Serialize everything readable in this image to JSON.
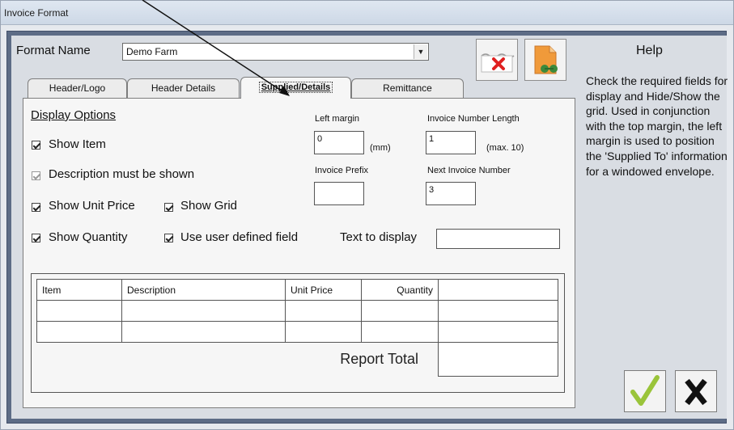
{
  "window": {
    "title": "Invoice Format"
  },
  "format": {
    "label": "Format Name",
    "value": "Demo Farm"
  },
  "toolbar": {
    "delete_icon": "delete-document-icon",
    "export_icon": "document-export-icon"
  },
  "tabs": [
    {
      "label": "Header/Logo"
    },
    {
      "label": "Header Details"
    },
    {
      "label": "Supplied/Details"
    },
    {
      "label": "Remittance"
    }
  ],
  "options": {
    "heading": "Display Options",
    "show_item": "Show Item",
    "description_must_be_shown": "Description must be shown",
    "show_unit_price": "Show Unit Price",
    "show_grid": "Show Grid",
    "show_quantity": "Show Quantity",
    "use_user_defined_field": "Use user defined field",
    "text_to_display": "Text to display",
    "text_to_display_value": ""
  },
  "fields": {
    "left_margin_label": "Left margin",
    "left_margin_value": "0",
    "left_margin_unit": "(mm)",
    "invoice_number_length_label": "Invoice Number Length",
    "invoice_number_length_value": "1",
    "invoice_number_length_hint": "(max. 10)",
    "invoice_prefix_label": "Invoice Prefix",
    "invoice_prefix_value": "",
    "next_invoice_number_label": "Next Invoice Number",
    "next_invoice_number_value": "3"
  },
  "preview_grid": {
    "headers": [
      "Item",
      "Description",
      "Unit Price",
      "Quantity",
      ""
    ],
    "total_label": "Report Total"
  },
  "help": {
    "title": "Help",
    "text": "Check the required fields for display and Hide/Show the grid. Used in conjunction with the top margin, the left margin is used to position the 'Supplied To' information for a windowed envelope."
  },
  "colors": {
    "frame": "#5d6c86",
    "panel": "#f6f6f6",
    "ok_check": "#9ac43a",
    "delete_x": "#e02020",
    "export_doc": "#f09a3a"
  }
}
